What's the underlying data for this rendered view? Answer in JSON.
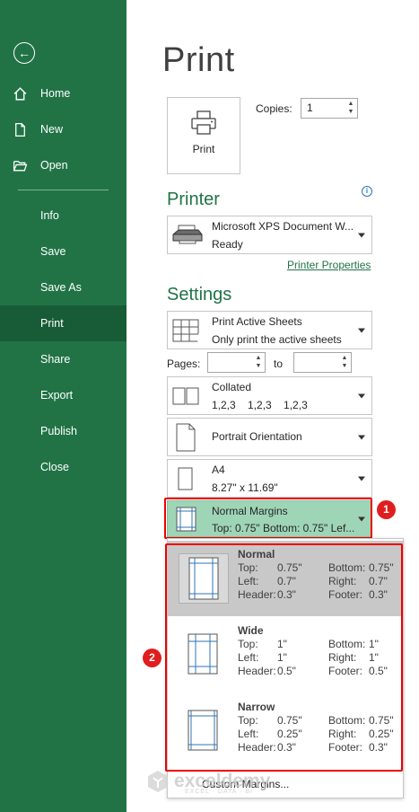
{
  "sidebar": {
    "back_icon": "arrow-left-circle-icon",
    "items": [
      {
        "label": "Home",
        "icon": "home-icon"
      },
      {
        "label": "New",
        "icon": "new-document-icon"
      },
      {
        "label": "Open",
        "icon": "open-folder-icon"
      },
      {
        "label": "Info"
      },
      {
        "label": "Save"
      },
      {
        "label": "Save As"
      },
      {
        "label": "Print",
        "active": true
      },
      {
        "label": "Share"
      },
      {
        "label": "Export"
      },
      {
        "label": "Publish"
      },
      {
        "label": "Close"
      }
    ]
  },
  "title": "Print",
  "print_button": {
    "label": "Print",
    "icon": "printer-icon"
  },
  "copies": {
    "label": "Copies:",
    "value": "1"
  },
  "printer": {
    "section": "Printer",
    "name": "Microsoft XPS Document W...",
    "status": "Ready",
    "properties_link": "Printer Properties",
    "info_icon": "info-icon"
  },
  "settings": {
    "section": "Settings",
    "active_sheets": {
      "line1": "Print Active Sheets",
      "line2": "Only print the active sheets"
    },
    "pages": {
      "label": "Pages:",
      "to": "to"
    },
    "collated": {
      "line1": "Collated",
      "line2": "1,2,3    1,2,3    1,2,3"
    },
    "orientation": {
      "line1": "Portrait Orientation"
    },
    "paper": {
      "line1": "A4",
      "line2": "8.27\" x 11.69\""
    },
    "margins": {
      "line1": "Normal Margins",
      "line2": "Top: 0.75\" Bottom: 0.75\" Lef..."
    }
  },
  "badges": {
    "one": "1",
    "two": "2"
  },
  "margin_options": [
    {
      "name": "Normal",
      "top_label": "Top:",
      "top": "0.75\"",
      "bottom_label": "Bottom:",
      "bottom": "0.75\"",
      "left_label": "Left:",
      "left": "0.7\"",
      "right_label": "Right:",
      "right": "0.7\"",
      "header_label": "Header:",
      "header": "0.3\"",
      "footer_label": "Footer:",
      "footer": "0.3\""
    },
    {
      "name": "Wide",
      "top_label": "Top:",
      "top": "1\"",
      "bottom_label": "Bottom:",
      "bottom": "1\"",
      "left_label": "Left:",
      "left": "1\"",
      "right_label": "Right:",
      "right": "1\"",
      "header_label": "Header:",
      "header": "0.5\"",
      "footer_label": "Footer:",
      "footer": "0.5\""
    },
    {
      "name": "Narrow",
      "top_label": "Top:",
      "top": "0.75\"",
      "bottom_label": "Bottom:",
      "bottom": "0.75\"",
      "left_label": "Left:",
      "left": "0.25\"",
      "right_label": "Right:",
      "right": "0.25\"",
      "header_label": "Header:",
      "header": "0.3\"",
      "footer_label": "Footer:",
      "footer": "0.3\""
    }
  ],
  "custom_margins": "Custom Margins...",
  "watermark": {
    "brand": "exceldemy",
    "tagline": "EXCEL · DATA · BI"
  },
  "colors": {
    "sidebar": "#217346",
    "sidebar_active": "#185c37",
    "accent": "#217346",
    "selected": "#9fd5b7",
    "highlight": "#e00000"
  }
}
